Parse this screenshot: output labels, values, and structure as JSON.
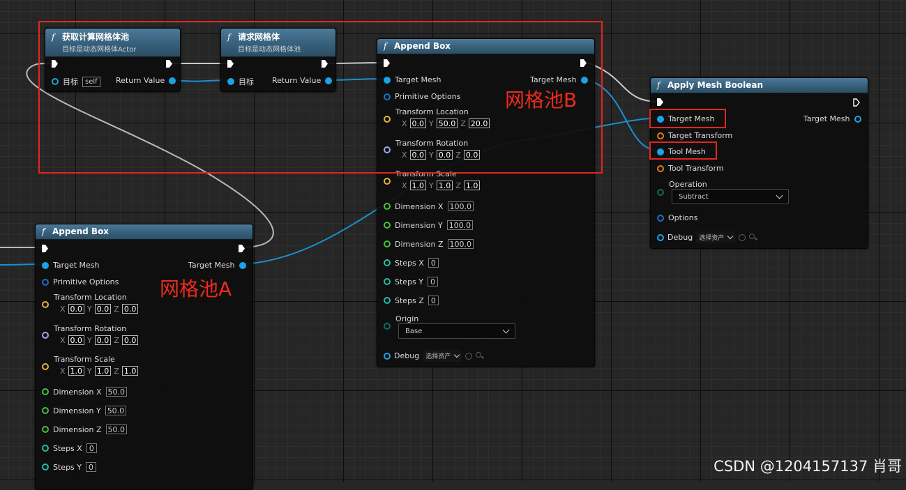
{
  "colors": {
    "mesh_pin": "#1ba3e8",
    "vector_pin": "#e8b32e",
    "rotator_pin": "#9fa8e6",
    "float_pin": "#44c23a",
    "int_pin": "#1fbfa0",
    "transform_pin": "#e37a1e",
    "header": "#3a6480",
    "annotation": "#ee2a1e"
  },
  "node_get_pool": {
    "title": "获取计算网格体池",
    "subtitle": "目标是动态网格体Actor",
    "target_label": "目标",
    "target_value": "self",
    "return_label": "Return Value"
  },
  "node_request_mesh": {
    "title": "请求网格体",
    "subtitle": "目标是动态网格体池",
    "target_label": "目标",
    "return_label": "Return Value"
  },
  "node_append_b": {
    "title": "Append Box",
    "target_mesh": "Target Mesh",
    "target_mesh_out": "Target Mesh",
    "primitive_options": "Primitive Options",
    "transform_location": "Transform Location",
    "loc": {
      "x": "0.0",
      "y": "50.0",
      "z": "20.0"
    },
    "transform_rotation": "Transform Rotation",
    "rot": {
      "x": "0.0",
      "y": "0.0",
      "z": "0.0"
    },
    "transform_scale": "Transform Scale",
    "scale": {
      "x": "1.0",
      "y": "1.0",
      "z": "1.0"
    },
    "dimension_x": "Dimension X",
    "dimension_x_value": "100.0",
    "dimension_y": "Dimension Y",
    "dimension_y_value": "100.0",
    "dimension_z": "Dimension Z",
    "dimension_z_value": "100.0",
    "steps_x": "Steps X",
    "steps_x_value": "0",
    "steps_y": "Steps Y",
    "steps_y_value": "0",
    "steps_z": "Steps Z",
    "steps_z_value": "0",
    "origin": "Origin",
    "origin_value": "Base",
    "debug": "Debug",
    "debug_value": "选择资产"
  },
  "node_append_a": {
    "title": "Append Box",
    "target_mesh": "Target Mesh",
    "target_mesh_out": "Target Mesh",
    "primitive_options": "Primitive Options",
    "transform_location": "Transform Location",
    "loc": {
      "x": "0.0",
      "y": "0.0",
      "z": "0.0"
    },
    "transform_rotation": "Transform Rotation",
    "rot": {
      "x": "0.0",
      "y": "0.0",
      "z": "0.0"
    },
    "transform_scale": "Transform Scale",
    "scale": {
      "x": "1.0",
      "y": "1.0",
      "z": "1.0"
    },
    "dimension_x": "Dimension X",
    "dimension_x_value": "50.0",
    "dimension_y": "Dimension Y",
    "dimension_y_value": "50.0",
    "dimension_z": "Dimension Z",
    "dimension_z_value": "50.0",
    "steps_x": "Steps X",
    "steps_x_value": "0",
    "steps_y": "Steps Y",
    "steps_y_value": "0"
  },
  "node_boolean": {
    "title": "Apply Mesh Boolean",
    "target_mesh": "Target Mesh",
    "target_mesh_out": "Target Mesh",
    "target_transform": "Target Transform",
    "tool_mesh": "Tool Mesh",
    "tool_transform": "Tool Transform",
    "operation": "Operation",
    "operation_value": "Subtract",
    "options": "Options",
    "debug": "Debug",
    "debug_value": "选择资产"
  },
  "axis": {
    "x": "X",
    "y": "Y",
    "z": "Z"
  },
  "annotations": {
    "pool_b": "网格池B",
    "pool_a": "网格池A"
  },
  "watermark": "CSDN @1204157137 肖哥"
}
